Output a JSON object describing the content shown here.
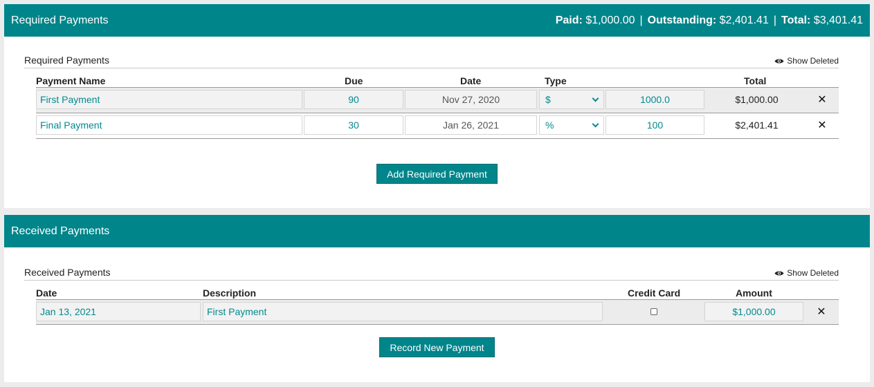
{
  "required": {
    "bar_title": "Required Payments",
    "summary": {
      "paid_label": "Paid:",
      "paid_value": "$1,000.00",
      "outstanding_label": "Outstanding:",
      "outstanding_value": "$2,401.41",
      "total_label": "Total:",
      "total_value": "$3,401.41",
      "separator": "|"
    },
    "section_title": "Required Payments",
    "show_deleted": "Show Deleted",
    "columns": {
      "name": "Payment Name",
      "due": "Due",
      "date": "Date",
      "type": "Type",
      "total": "Total"
    },
    "rows": [
      {
        "name": "First Payment",
        "due": "90",
        "date": "Nov 27, 2020",
        "type": "$",
        "amount": "1000.0",
        "total": "$1,000.00",
        "remove": "✕"
      },
      {
        "name": "Final Payment",
        "due": "30",
        "date": "Jan 26, 2021",
        "type": "%",
        "amount": "100",
        "total": "$2,401.41",
        "remove": "✕"
      }
    ],
    "add_button": "Add Required Payment"
  },
  "received": {
    "bar_title": "Received Payments",
    "section_title": "Received Payments",
    "show_deleted": "Show Deleted",
    "columns": {
      "date": "Date",
      "description": "Description",
      "credit_card": "Credit Card",
      "amount": "Amount"
    },
    "rows": [
      {
        "date": "Jan 13, 2021",
        "description": "First Payment",
        "credit_card": false,
        "amount": "$1,000.00",
        "remove": "✕"
      }
    ],
    "record_button": "Record New Payment"
  },
  "colors": {
    "accent": "#00858a",
    "link": "#008a8f",
    "background": "#ececec"
  },
  "icons": {
    "show_deleted": "eye-icon",
    "remove": "close-icon",
    "select": "chevron-down-icon"
  }
}
